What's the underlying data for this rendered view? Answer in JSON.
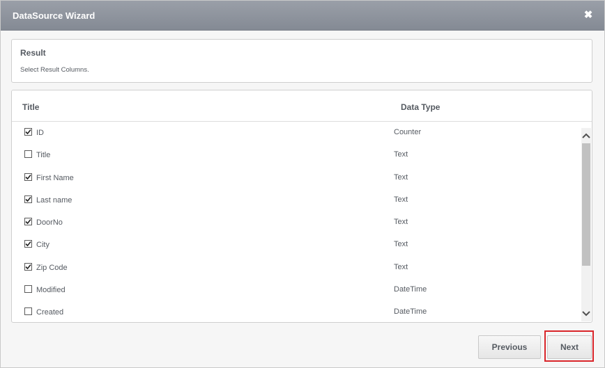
{
  "dialog": {
    "title": "DataSource Wizard",
    "close_icon": "close-icon"
  },
  "result": {
    "heading": "Result",
    "subtitle": "Select Result Columns."
  },
  "grid": {
    "columns": [
      "Title",
      "Data Type"
    ],
    "rows": [
      {
        "name": "ID",
        "type": "Counter",
        "checked": true
      },
      {
        "name": "Title",
        "type": "Text",
        "checked": false
      },
      {
        "name": "First Name",
        "type": "Text",
        "checked": true
      },
      {
        "name": "Last name",
        "type": "Text",
        "checked": true
      },
      {
        "name": "DoorNo",
        "type": "Text",
        "checked": true
      },
      {
        "name": "City",
        "type": "Text",
        "checked": true
      },
      {
        "name": "Zip Code",
        "type": "Text",
        "checked": true
      },
      {
        "name": "Modified",
        "type": "DateTime",
        "checked": false
      },
      {
        "name": "Created",
        "type": "DateTime",
        "checked": false
      }
    ]
  },
  "footer": {
    "previous_label": "Previous",
    "next_label": "Next"
  },
  "colors": {
    "titlebar": "#8e939c",
    "highlight": "#d9252a",
    "text": "#555a61"
  }
}
